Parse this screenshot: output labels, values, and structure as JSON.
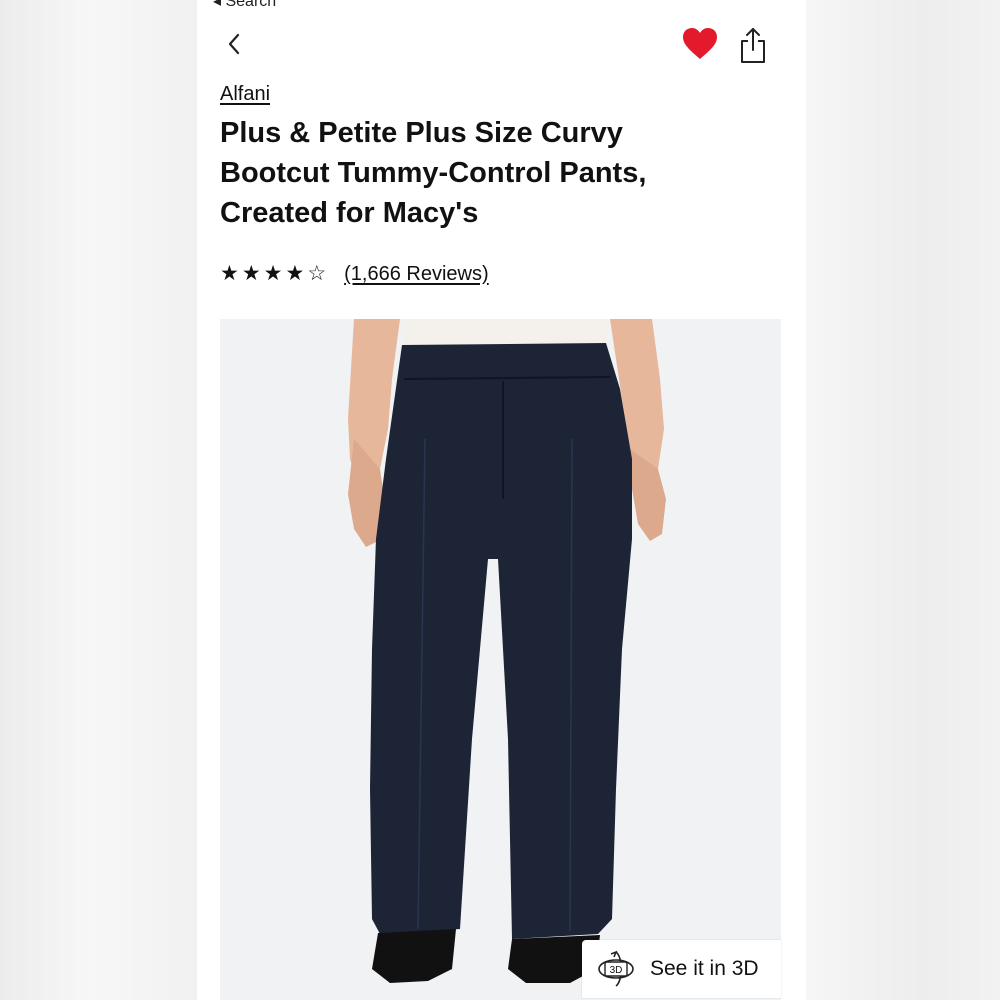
{
  "status_bar": {
    "back_label": "◂ Search"
  },
  "header": {
    "back_icon": "chevron-left-icon",
    "favorite_icon": "heart-icon",
    "favorite_color": "#e21a2c",
    "share_icon": "share-icon"
  },
  "product": {
    "brand": "Alfani",
    "title": "Plus & Petite Plus Size Curvy Bootcut Tummy-Control Pants, Created for Macy's",
    "rating_stars": [
      "★",
      "★",
      "★",
      "★",
      "☆"
    ],
    "rating_value": 4,
    "reviews_label": "(1,666 Reviews)"
  },
  "image": {
    "view_3d_label": "See it in 3D",
    "view_3d_badge": "3D",
    "pants_color": "#1c2436"
  }
}
